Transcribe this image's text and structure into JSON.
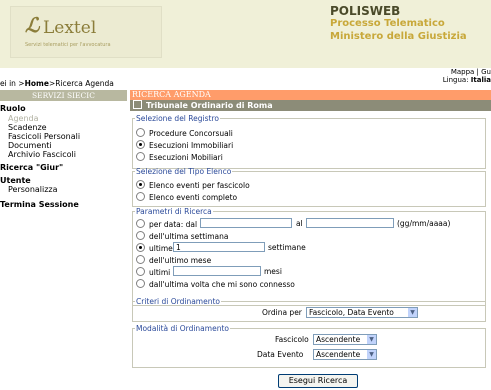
{
  "header": {
    "logo_mark": "ℒ",
    "logo_name": "Lextel",
    "logo_tagline": "Servizi telematici per l'avvocatura",
    "title": "POLISWEB",
    "subtitle1": "Processo Telematico",
    "subtitle2": "Ministero della Giustizia"
  },
  "breadcrumb": {
    "prefix": "ei in >",
    "home": "Home",
    "rest": ">Ricerca Agenda"
  },
  "top_right": {
    "mappa": "Mappa | Gu",
    "lingua_label": "Lingua: ",
    "lingua_value": "Italia"
  },
  "sidebar": {
    "header": "SERVIZI SIECIC",
    "items": [
      {
        "label": "Ruolo"
      },
      {
        "label": "Agenda"
      },
      {
        "label": "Scadenze"
      },
      {
        "label": "Fascicoli Personali"
      },
      {
        "label": "Documenti"
      },
      {
        "label": "Archivio Fascicoli"
      },
      {
        "label": "Ricerca \"Giur\""
      },
      {
        "label": "Utente"
      },
      {
        "label": "Personalizza"
      },
      {
        "label": "Termina Sessione"
      }
    ]
  },
  "main": {
    "title": "RICERCA AGENDA",
    "court": "Tribunale Ordinario di Roma",
    "registro": {
      "legend": "Selezione del Registro",
      "options": [
        "Procedure Concorsuali",
        "Esecuzioni Immobiliari",
        "Esecuzioni Mobiliari"
      ],
      "selected": 1
    },
    "tipo_elenco": {
      "legend": "Selezione del Tipo Elenco",
      "options": [
        "Elenco eventi per fascicolo",
        "Elenco eventi completo"
      ],
      "selected": 0
    },
    "parametri": {
      "legend": "Parametri di Ricerca",
      "per_data": "per data: dal",
      "al": "al",
      "date_format": "(gg/mm/aaaa)",
      "ultima_settimana": "dell'ultima settimana",
      "ultime": "ultime",
      "ultime_value": "1",
      "settimane": "settimane",
      "ultimo_mese": "dell'ultimo mese",
      "ultimi": "ultimi",
      "mesi": "mesi",
      "ultima_volta": "dall'ultima volta che mi sono connesso",
      "selected": 2
    },
    "criteri": {
      "legend": "Criteri di Ordinamento",
      "ordina_per_label": "Ordina per",
      "ordina_per_value": "Fascicolo, Data Evento"
    },
    "modalita": {
      "legend": "Modalità di Ordinamento",
      "fascicolo_label": "Fascicolo",
      "fascicolo_value": "Ascendente",
      "data_evento_label": "Data Evento",
      "data_evento_value": "Ascendente"
    },
    "submit": "Esegui Ricerca"
  }
}
